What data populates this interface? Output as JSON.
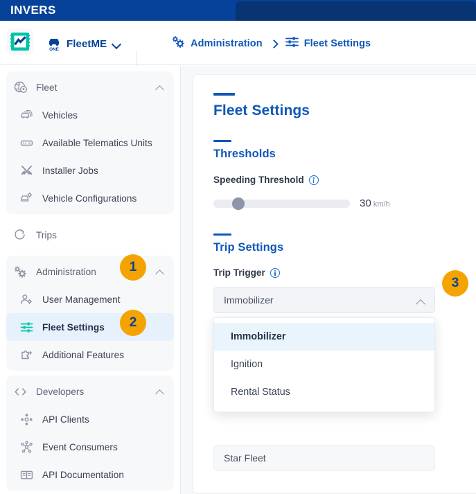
{
  "brand": {
    "name": "INVERS"
  },
  "header": {
    "tenant_logo_icon": "invers-one-logo-icon",
    "org_icon": "one-vehicle-icon",
    "org_name": "FleetME",
    "org_chevron_icon": "chevron-down-icon",
    "breadcrumb": [
      {
        "icon": "gears-icon",
        "label": "Administration"
      },
      {
        "icon": "sliders-icon",
        "label": "Fleet Settings"
      }
    ],
    "breadcrumb_separator_icon": "chevron-right-icon"
  },
  "sidebar": {
    "groups": [
      {
        "name": "fleet",
        "boxed": true,
        "parent": {
          "icon": "globe-pin-icon",
          "label": "Fleet",
          "chevron": "chevron-up-icon"
        },
        "items": [
          {
            "icon": "cars-icon",
            "label": "Vehicles",
            "active": false
          },
          {
            "icon": "telematics-unit-icon",
            "label": "Available Telematics Units",
            "active": false
          },
          {
            "icon": "tools-icon",
            "label": "Installer Jobs",
            "active": false
          },
          {
            "icon": "vehicle-config-icon",
            "label": "Vehicle Configurations",
            "active": false
          }
        ]
      },
      {
        "name": "trips",
        "boxed": false,
        "parent": {
          "icon": "trip-route-icon",
          "label": "Trips",
          "chevron": ""
        },
        "items": []
      },
      {
        "name": "administration",
        "boxed": true,
        "parent": {
          "icon": "gears-icon",
          "label": "Administration",
          "chevron": "chevron-up-icon"
        },
        "items": [
          {
            "icon": "user-gear-icon",
            "label": "User Management",
            "active": false
          },
          {
            "icon": "sliders-icon",
            "label": "Fleet Settings",
            "active": true
          },
          {
            "icon": "puzzle-plus-icon",
            "label": "Additional Features",
            "active": false
          }
        ]
      },
      {
        "name": "developers",
        "boxed": true,
        "parent": {
          "icon": "code-brackets-icon",
          "label": "Developers",
          "chevron": "chevron-up-icon"
        },
        "items": [
          {
            "icon": "api-clients-icon",
            "label": "API Clients",
            "active": false
          },
          {
            "icon": "event-consumers-icon",
            "label": "Event Consumers",
            "active": false
          },
          {
            "icon": "book-icon",
            "label": "API Documentation",
            "active": false
          }
        ]
      }
    ]
  },
  "main": {
    "page_title": "Fleet Settings",
    "thresholds": {
      "section_title": "Thresholds",
      "speeding_label": "Speeding Threshold",
      "speeding_info_icon": "info-icon",
      "speeding_value": "30",
      "speeding_unit": "km/h",
      "speeding_percent": 15
    },
    "trip_settings": {
      "section_title": "Trip Settings",
      "trip_trigger_label": "Trip Trigger",
      "trip_trigger_info_icon": "info-icon",
      "trip_trigger_value": "Immobilizer",
      "trip_trigger_chevron_icon": "chevron-up-icon",
      "options": [
        {
          "label": "Immobilizer",
          "selected": true
        },
        {
          "label": "Ignition",
          "selected": false
        },
        {
          "label": "Rental Status",
          "selected": false
        }
      ],
      "obscured_field_value": "Star Fleet"
    }
  },
  "step_badges": [
    {
      "id": "badge1",
      "number": "1"
    },
    {
      "id": "badge2",
      "number": "2"
    },
    {
      "id": "badge3",
      "number": "3"
    }
  ],
  "colors": {
    "brand_blue": "#06429a",
    "brand_blue_dark": "#083473",
    "accent_blue": "#1057b8",
    "teal": "#00c4a7",
    "badge_orange": "#f5a300",
    "active_bg": "#e7f1fb"
  }
}
